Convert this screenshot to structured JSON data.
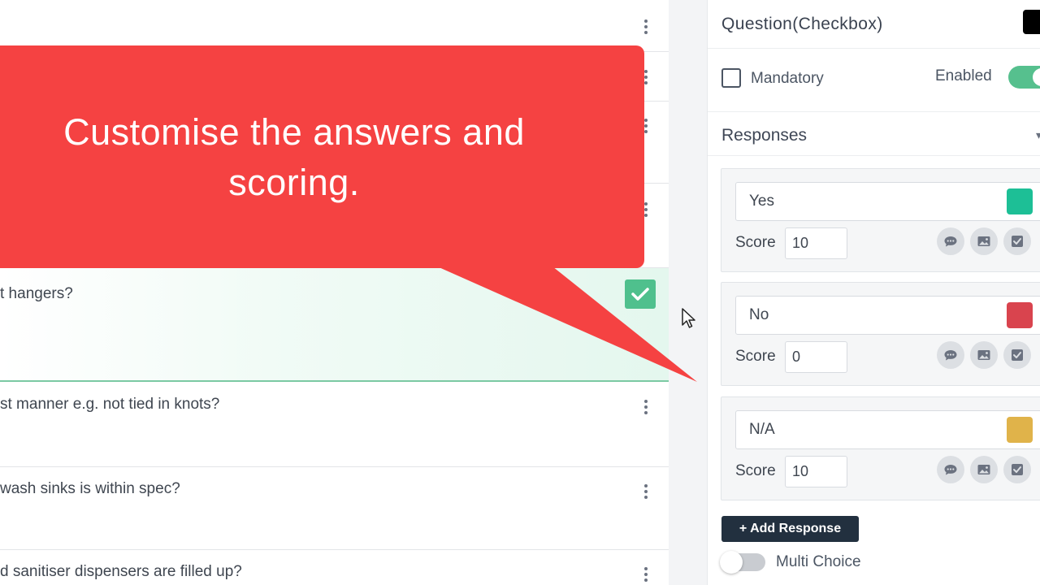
{
  "questions": [
    {
      "text": ""
    },
    {
      "text": ""
    },
    {
      "text": ""
    },
    {
      "text": ""
    },
    {
      "text": "t hangers?"
    },
    {
      "text": "st manner e.g. not tied in knots?"
    },
    {
      "text": "wash sinks is within spec?"
    },
    {
      "text": "d sanitiser dispensers are filled up?"
    }
  ],
  "callout": {
    "line1": "Customise the answers and",
    "line2": "scoring.",
    "color": "#f54242"
  },
  "panel": {
    "title": "Question(Checkbox)",
    "mandatory_label": "Mandatory",
    "mandatory_checked": false,
    "enabled_label": "Enabled",
    "enabled_on": true,
    "responses_title": "Responses",
    "score_label": "Score",
    "responses": [
      {
        "name": "Yes",
        "score": "10",
        "color": "#1dbf96"
      },
      {
        "name": "No",
        "score": "0",
        "color": "#d9444e"
      },
      {
        "name": "N/A",
        "score": "10",
        "color": "#e0b34a"
      }
    ],
    "add_response_label": "+ Add Response",
    "multi_choice_label": "Multi Choice",
    "multi_choice_on": false
  },
  "icons": {
    "kebab": "kebab-menu-icon",
    "check": "checkmark-icon",
    "comment": "comment-icon",
    "image": "image-icon",
    "checkbox": "checkbox-icon",
    "cursor": "mouse-pointer-icon"
  }
}
